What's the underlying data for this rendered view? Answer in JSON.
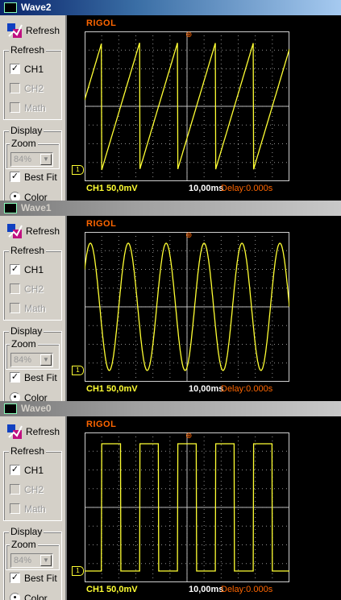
{
  "windows": [
    {
      "title": "Wave2",
      "refresh_label": "Refresh",
      "refresh_group": "Refresh",
      "ch1": "CH1",
      "ch2": "CH2",
      "math": "Math",
      "display_group": "Display",
      "zoom_group": "Zoom",
      "zoom_value": "84%",
      "best_fit": "Best Fit",
      "color_label": "Color",
      "brand": "RIGOL",
      "status_ch": "CH1 50,0mV",
      "status_time": "10,00ms",
      "status_delay": "Delay:0.000s",
      "waveform": "sawtooth",
      "active": true
    },
    {
      "title": "Wave1",
      "refresh_label": "Refresh",
      "refresh_group": "Refresh",
      "ch1": "CH1",
      "ch2": "CH2",
      "math": "Math",
      "display_group": "Display",
      "zoom_group": "Zoom",
      "zoom_value": "84%",
      "best_fit": "Best Fit",
      "color_label": "Color",
      "brand": "RIGOL",
      "status_ch": "CH1 50,0mV",
      "status_time": "10,00ms",
      "status_delay": "Delay:0.000s",
      "waveform": "sine",
      "active": false
    },
    {
      "title": "Wave0",
      "refresh_label": "Refresh",
      "refresh_group": "Refresh",
      "ch1": "CH1",
      "ch2": "CH2",
      "math": "Math",
      "display_group": "Display",
      "zoom_group": "Zoom",
      "zoom_value": "84%",
      "best_fit": "Best Fit",
      "color_label": "Color",
      "brand": "RIGOL",
      "status_ch": "CH1 50,0mV",
      "status_time": "10,00ms",
      "status_delay": "Delay:0.000s",
      "waveform": "square",
      "active": false
    }
  ],
  "colors": {
    "trace": "#ffff33",
    "brand": "#ff6600",
    "grid": "#cfcfcf",
    "screen": "#000000"
  }
}
